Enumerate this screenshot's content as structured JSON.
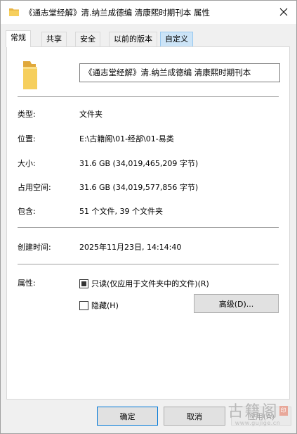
{
  "window": {
    "title": "《通志堂经解》清.纳兰成德编 清康熙时期刊本 属性"
  },
  "tabs": [
    {
      "label": "常规"
    },
    {
      "label": "共享"
    },
    {
      "label": "安全"
    },
    {
      "label": "以前的版本"
    },
    {
      "label": "自定义"
    }
  ],
  "general": {
    "name": "《通志堂经解》清.纳兰成德编 清康熙时期刊本",
    "type_label": "类型:",
    "type_value": "文件夹",
    "location_label": "位置:",
    "location_value": "E:\\古籍阁\\01-经部\\01-易类",
    "size_label": "大小:",
    "size_value": "31.6 GB (34,019,465,209 字节)",
    "size_on_disk_label": "占用空间:",
    "size_on_disk_value": "31.6 GB (34,019,577,856 字节)",
    "contains_label": "包含:",
    "contains_value": "51 个文件, 39 个文件夹",
    "created_label": "创建时间:",
    "created_value": "2025年11月23日, 14:14:40",
    "attributes_label": "属性:",
    "readonly_label": "只读(仅应用于文件夹中的文件)(R)",
    "hidden_label": "隐藏(H)",
    "advanced_label": "高级(D)..."
  },
  "buttons": {
    "ok": "确定",
    "cancel": "取消",
    "apply": "应用(A)"
  },
  "watermark": {
    "text": "古籍阁",
    "url": "www.gujige.cn"
  },
  "colors": {
    "folder": "#f0c24e",
    "accent": "#0078d7",
    "custom_tab_bg": "#cce4f7"
  }
}
